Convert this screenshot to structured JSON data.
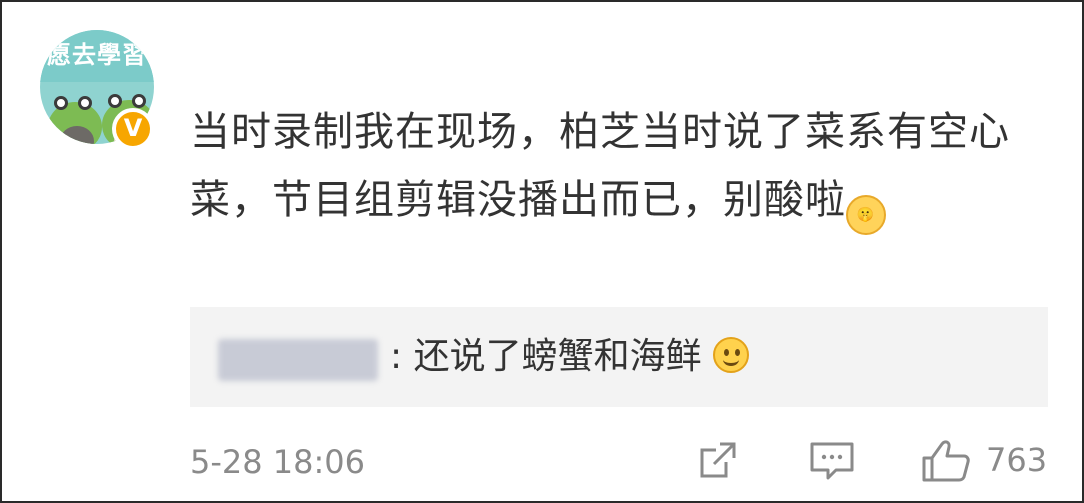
{
  "user": {
    "avatar_banner_text": "愿去學習",
    "verified_badge": "V",
    "verified_color": "#f7a600"
  },
  "comment": {
    "text": "当时录制我在现场，柏芝当时说了菜系有空心菜，节目组剪辑没播出而已，别酸啦",
    "emoji_icon": "shush-emoji"
  },
  "reply": {
    "author_blurred": true,
    "text": ": 还说了螃蟹和海鲜",
    "emoji_icon": "smile-emoji"
  },
  "footer": {
    "timestamp": "5-28 18:06",
    "share_icon": "share-icon",
    "comment_icon": "comment-icon",
    "like_icon": "like-icon",
    "like_count": "763"
  },
  "colors": {
    "text": "#333333",
    "muted": "#8a8a8a",
    "reply_bg": "#f3f3f3"
  }
}
